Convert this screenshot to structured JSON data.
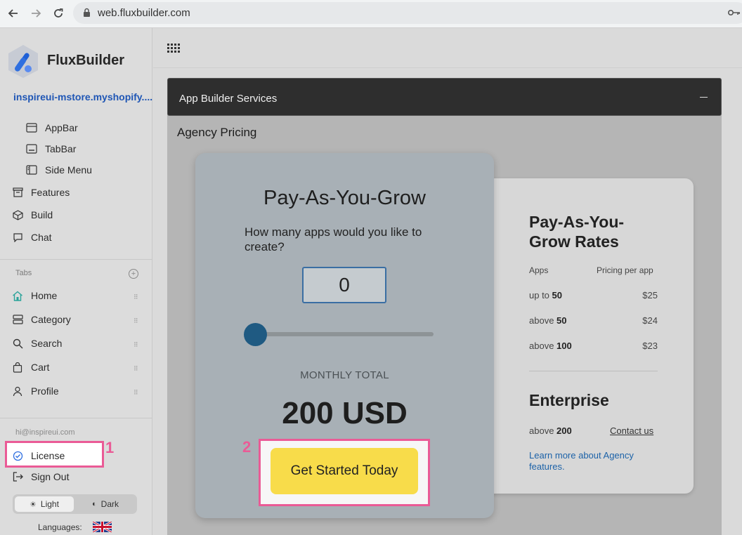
{
  "browser": {
    "url": "web.fluxbuilder.com"
  },
  "sidebar": {
    "brand": "FluxBuilder",
    "store": "inspireui-mstore.myshopify....",
    "sub_items": [
      {
        "label": "AppBar",
        "icon": "appbar-icon"
      },
      {
        "label": "TabBar",
        "icon": "tabbar-icon"
      },
      {
        "label": "Side Menu",
        "icon": "side-menu-icon"
      }
    ],
    "items": [
      {
        "label": "Features",
        "icon": "features-icon"
      },
      {
        "label": "Build",
        "icon": "build-icon"
      },
      {
        "label": "Chat",
        "icon": "chat-icon"
      }
    ],
    "tabs_title": "Tabs",
    "tabs": [
      {
        "label": "Home",
        "icon": "home-icon"
      },
      {
        "label": "Category",
        "icon": "category-icon"
      },
      {
        "label": "Search",
        "icon": "search-icon"
      },
      {
        "label": "Cart",
        "icon": "cart-icon"
      },
      {
        "label": "Profile",
        "icon": "profile-icon"
      }
    ],
    "email": "hi@inspireui.com",
    "license_label": "License",
    "signout_label": "Sign Out",
    "theme": {
      "light": "Light",
      "dark": "Dark"
    },
    "languages_label": "Languages:"
  },
  "annotations": {
    "first": "1",
    "second": "2"
  },
  "main": {
    "panel_title": "App Builder Services",
    "section_title": "Agency Pricing",
    "grow_card": {
      "title": "Pay-As-You-Grow",
      "question": "How many apps would you like to create?",
      "app_count": "0",
      "slider_value": 0,
      "monthly_label": "MONTHLY TOTAL",
      "total": "200 USD",
      "cta": "Get Started Today"
    },
    "rates_card": {
      "title": "Pay-As-You-Grow Rates",
      "col_apps": "Apps",
      "col_price": "Pricing per app",
      "rows": [
        {
          "prefix": "up to",
          "qty": "50",
          "price": "$25"
        },
        {
          "prefix": "above",
          "qty": "50",
          "price": "$24"
        },
        {
          "prefix": "above",
          "qty": "100",
          "price": "$23"
        }
      ],
      "enterprise_title": "Enterprise",
      "enterprise_prefix": "above",
      "enterprise_qty": "200",
      "contact": "Contact us",
      "learn_more": "Learn more about Agency features."
    }
  },
  "colors": {
    "accent_pink": "#ea5b96",
    "cta_yellow": "#f8dc4a",
    "link_blue": "#1f56b5",
    "slider_thumb": "#1f5a82"
  }
}
